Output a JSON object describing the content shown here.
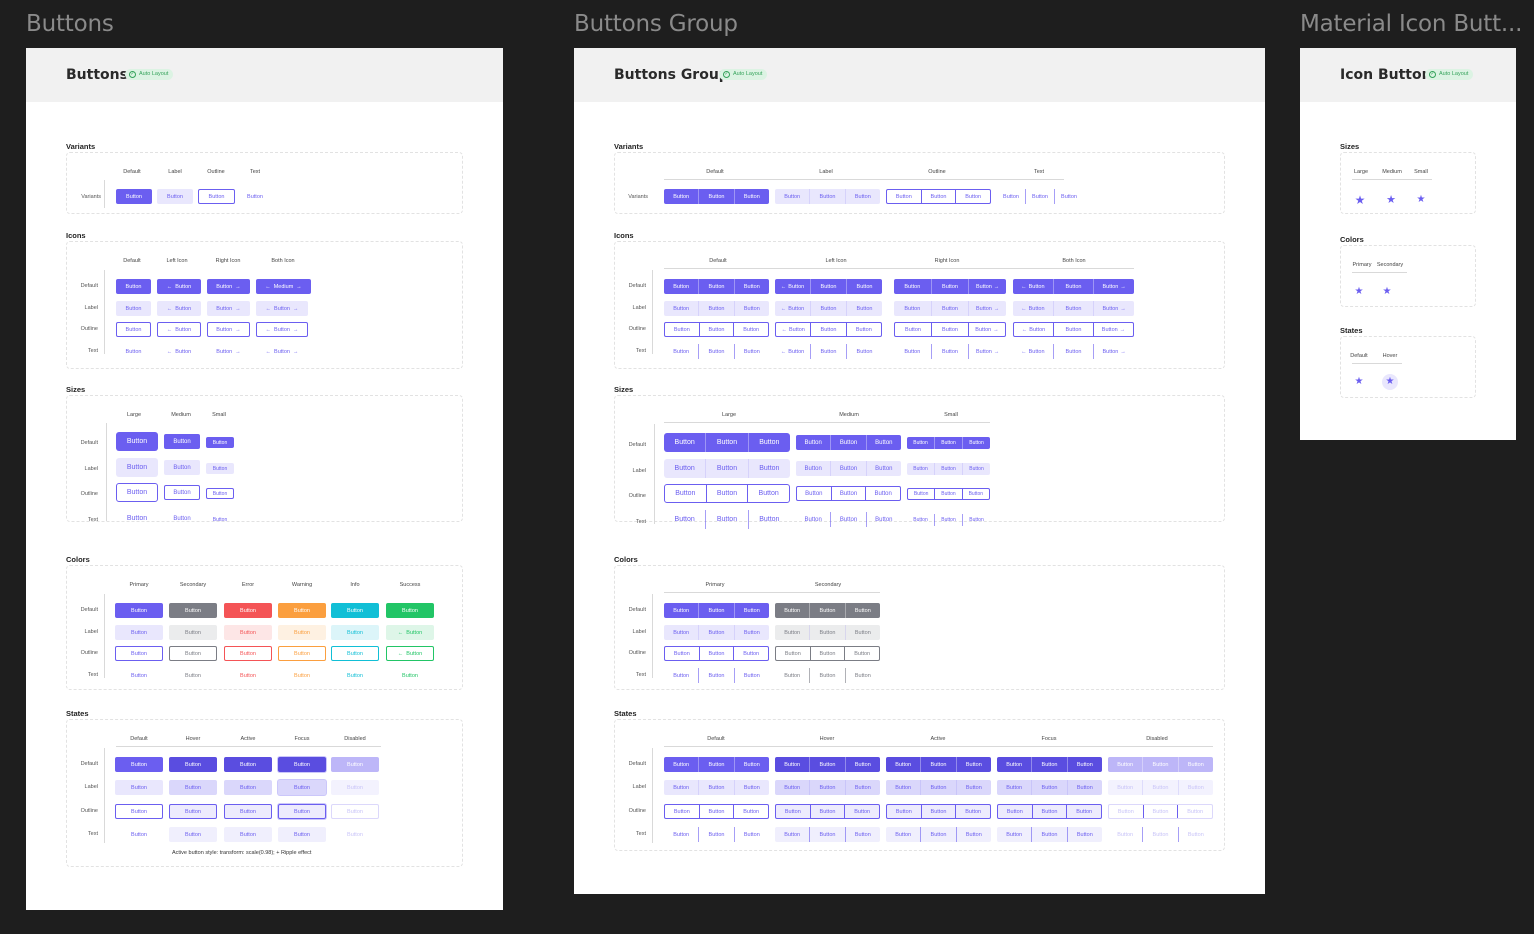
{
  "frame_titles": {
    "buttons": "Buttons",
    "buttons_group": "Buttons Group",
    "icon_buttons": "Material Icon Butt..."
  },
  "badge_label": "Auto Layout",
  "button_label": "Button",
  "medium_label": "Medium",
  "row_labels": {
    "default": "Default",
    "label": "Label",
    "outline": "Outline",
    "text": "Text",
    "variants": "Variants"
  },
  "buttons_frame": {
    "header": "Buttons",
    "variants": {
      "title": "Variants",
      "columns": [
        "Default",
        "Label",
        "Outline",
        "Text"
      ]
    },
    "icons": {
      "title": "Icons",
      "columns": [
        "Default",
        "Left Icon",
        "Right Icon",
        "Both Icon"
      ]
    },
    "sizes": {
      "title": "Sizes",
      "columns": [
        "Large",
        "Medium",
        "Small"
      ]
    },
    "colors": {
      "title": "Colors",
      "columns": [
        "Primary",
        "Secondary",
        "Error",
        "Warning",
        "Info",
        "Success"
      ]
    },
    "states": {
      "title": "States",
      "columns": [
        "Default",
        "Hover",
        "Active",
        "Focus",
        "Disabled"
      ],
      "note": "Active button style: transform: scale(0.98); + Ripple effect"
    }
  },
  "group_frame": {
    "header": "Buttons Group",
    "variants": {
      "title": "Variants",
      "columns": [
        "Default",
        "Label",
        "Outline",
        "Text"
      ]
    },
    "icons": {
      "title": "Icons",
      "columns": [
        "Default",
        "Left Icon",
        "Right Icon",
        "Both Icon"
      ]
    },
    "sizes": {
      "title": "Sizes",
      "columns": [
        "Large",
        "Medium",
        "Small"
      ]
    },
    "colors": {
      "title": "Colors",
      "columns": [
        "Primary",
        "Secondary"
      ]
    },
    "states": {
      "title": "States",
      "columns": [
        "Default",
        "Hover",
        "Active",
        "Focus",
        "Disabled"
      ]
    }
  },
  "icon_frame": {
    "header": "Icon Button",
    "sizes": {
      "title": "Sizes",
      "columns": [
        "Large",
        "Medium",
        "Small"
      ]
    },
    "colors": {
      "title": "Colors",
      "columns": [
        "Primary",
        "Secondary"
      ]
    },
    "states": {
      "title": "States",
      "columns": [
        "Default",
        "Hover"
      ]
    }
  },
  "icons": {
    "arrow_left": "arrow-left-icon",
    "arrow_right": "arrow-right-icon",
    "star": "star-icon",
    "check": "check-circle-icon"
  },
  "colors": {
    "primary": "#6b5ef0",
    "secondary": "#7b7d85",
    "error": "#f45456",
    "warning": "#fb9f3f",
    "info": "#11bfd6",
    "success": "#22c566"
  }
}
